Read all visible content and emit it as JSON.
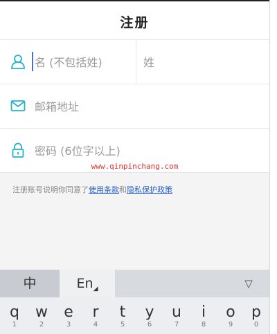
{
  "header": {
    "title": "注册"
  },
  "form": {
    "first_name_placeholder": "名 (不包括姓)",
    "last_name_placeholder": "姓",
    "email_placeholder": "邮箱地址",
    "password_placeholder": "密码 (6位字以上)"
  },
  "watermark": "www.qinpinchang.com",
  "terms": {
    "prefix": "注册账号说明你同意了",
    "terms_link": "使用条款",
    "joiner": "和",
    "privacy_link": "隐私保护政策"
  },
  "keyboard": {
    "chinese_key": "中",
    "english_key": "En",
    "hide_key": "▽",
    "letters": [
      "q",
      "w",
      "e",
      "r",
      "t",
      "y",
      "u",
      "i",
      "o",
      "p"
    ],
    "numbers": [
      "1",
      "2",
      "3",
      "4",
      "5",
      "6",
      "7",
      "8",
      "9",
      "0"
    ]
  },
  "colors": {
    "accent": "#1fb5c9",
    "link": "#2a62c9",
    "cursor": "#4a6fd8"
  }
}
